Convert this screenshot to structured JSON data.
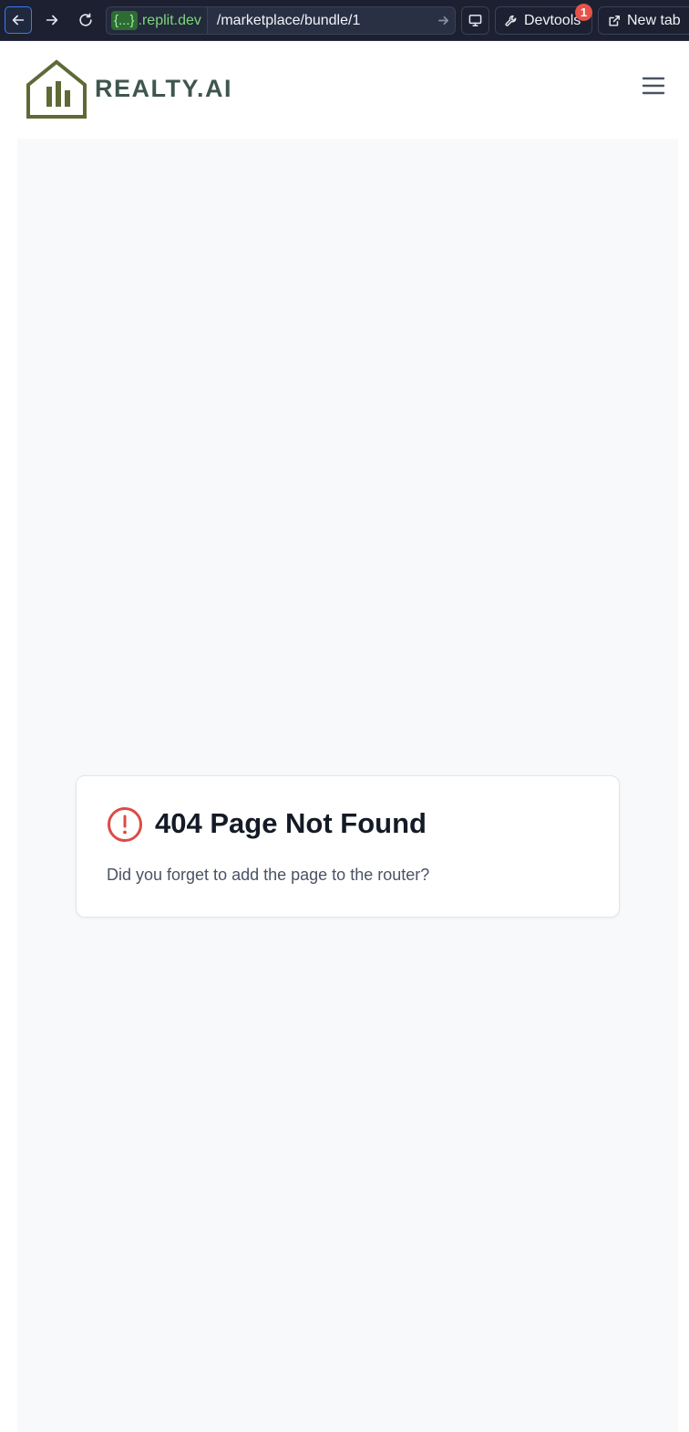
{
  "browser": {
    "url_host_chip": "{...}",
    "url_host": ".replit.dev",
    "url_path": "/marketplace/bundle/1",
    "devtools_label": "Devtools",
    "devtools_badge": "1",
    "new_tab_label": "New tab",
    "icons": [
      "back-arrow-icon",
      "forward-arrow-icon",
      "reload-icon",
      "go-arrow-icon",
      "monitor-icon",
      "wrench-icon",
      "external-link-icon"
    ]
  },
  "header": {
    "brand": "REALTY.AI",
    "logo_icon": "house-bar-chart-logo",
    "menu_icon": "hamburger-menu-icon"
  },
  "error_card": {
    "icon": "alert-circle-icon",
    "title": "404 Page Not Found",
    "message": "Did you forget to add the page to the router?"
  },
  "colors": {
    "toolbar_bg": "#1c2030",
    "focus_blue": "#3a7bf0",
    "host_green": "#7ed67a",
    "badge_red": "#e5534b",
    "logo_olive": "#5e6a35",
    "brand_text": "#3f564f",
    "page_bg": "#f8f9fb",
    "error_red": "#dc4b45",
    "title_text": "#141a26"
  }
}
